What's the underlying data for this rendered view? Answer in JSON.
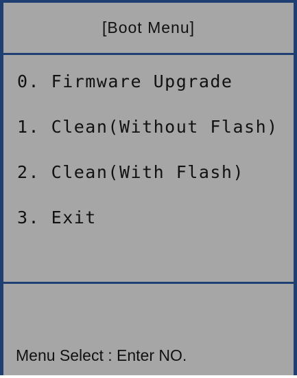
{
  "header": {
    "title": "[Boot Menu]"
  },
  "menu": {
    "items": [
      {
        "label": "0. Firmware Upgrade"
      },
      {
        "label": "1. Clean(Without Flash)"
      },
      {
        "label": "2. Clean(With Flash)"
      },
      {
        "label": "3. Exit"
      }
    ]
  },
  "status": {
    "prompt": "Menu Select : Enter NO."
  },
  "colors": {
    "background": "#a6a6a6",
    "border": "#1f3f73",
    "text": "#111111"
  }
}
